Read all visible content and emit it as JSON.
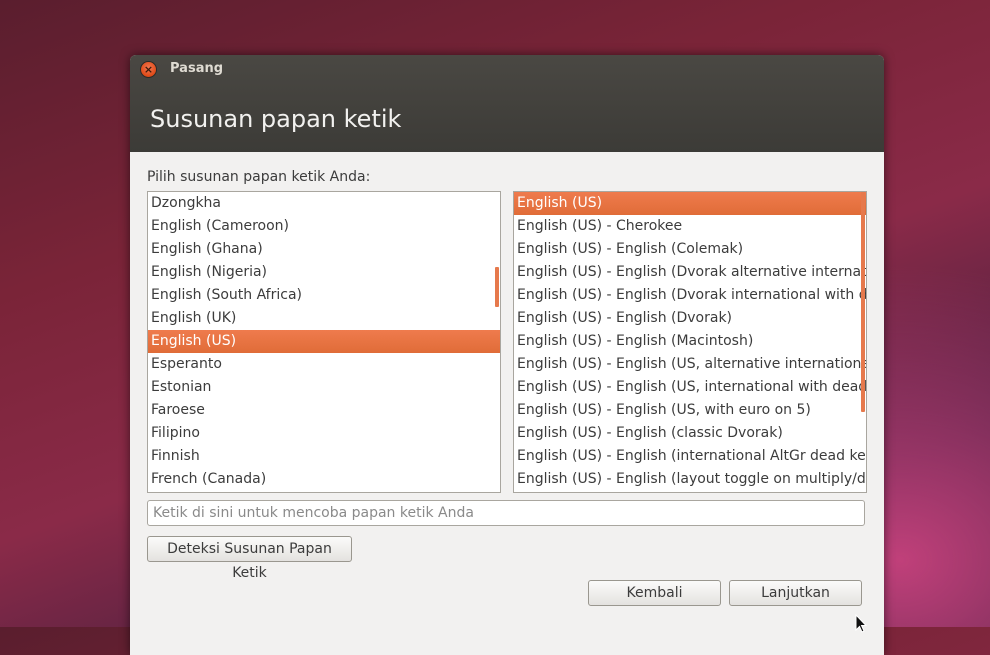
{
  "window": {
    "title": "Pasang",
    "close_glyph": "×"
  },
  "page": {
    "title": "Susunan papan ketik",
    "prompt": "Pilih susunan papan ketik Anda:"
  },
  "layouts_list": {
    "items": [
      "Dzongkha",
      "English (Cameroon)",
      "English (Ghana)",
      "English (Nigeria)",
      "English (South Africa)",
      "English (UK)",
      "English (US)",
      "Esperanto",
      "Estonian",
      "Faroese",
      "Filipino",
      "Finnish",
      "French (Canada)"
    ],
    "selected_index": 6
  },
  "variants_list": {
    "items": [
      "English (US)",
      "English (US) - Cherokee",
      "English (US) - English (Colemak)",
      "English (US) - English (Dvorak alternative international no dead keys)",
      "English (US) - English (Dvorak international with dead keys)",
      "English (US) - English (Dvorak)",
      "English (US) - English (Macintosh)",
      "English (US) - English (US, alternative international)",
      "English (US) - English (US, international with dead keys)",
      "English (US) - English (US, with euro on 5)",
      "English (US) - English (classic Dvorak)",
      "English (US) - English (international AltGr dead keys)",
      "English (US) - English (layout toggle on multiply/divide key)"
    ],
    "selected_index": 0
  },
  "test_input": {
    "placeholder": "Ketik di sini untuk mencoba papan ketik Anda",
    "value": ""
  },
  "buttons": {
    "detect": "Deteksi Susunan Papan Ketik",
    "back": "Kembali",
    "next": "Lanjutkan"
  },
  "colors": {
    "accent": "#e87548",
    "header_bg": "#3c3b37"
  },
  "icons": {
    "close": "close-icon",
    "cursor": "mouse-pointer-icon"
  }
}
